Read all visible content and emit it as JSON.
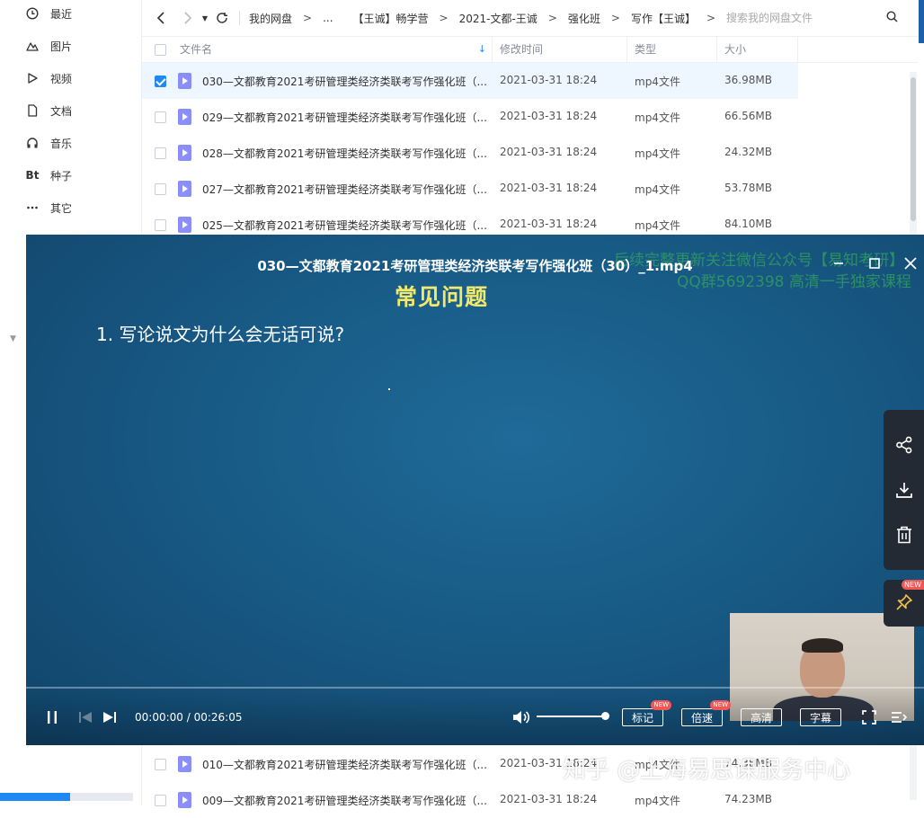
{
  "sidebar": {
    "items": [
      {
        "label": "最近",
        "icon": "clock-icon"
      },
      {
        "label": "图片",
        "icon": "image-icon"
      },
      {
        "label": "视频",
        "icon": "play-icon"
      },
      {
        "label": "文档",
        "icon": "document-icon"
      },
      {
        "label": "音乐",
        "icon": "headphones-icon"
      },
      {
        "label": "种子",
        "icon": "bt-icon",
        "glyph": "Bt"
      },
      {
        "label": "其它",
        "icon": "more-icon"
      }
    ],
    "storage_fill": 0.53
  },
  "toolbar": {
    "breadcrumbs": [
      "我的网盘",
      "...",
      "【王诚】畅学营",
      "2021-文都-王诚",
      "强化班",
      "写作【王诚】"
    ],
    "search_placeholder": "搜索我的网盘文件"
  },
  "table": {
    "headers": {
      "name": "文件名",
      "modified": "修改时间",
      "type": "类型",
      "size": "大小"
    },
    "rows": [
      {
        "name": "030—文都教育2021考研管理类经济类联考写作强化班（...",
        "time": "2021-03-31 18:24",
        "type": "mp4文件",
        "size": "36.98MB",
        "selected": true
      },
      {
        "name": "029—文都教育2021考研管理类经济类联考写作强化班（...",
        "time": "2021-03-31 18:24",
        "type": "mp4文件",
        "size": "66.56MB",
        "selected": false
      },
      {
        "name": "028—文都教育2021考研管理类经济类联考写作强化班（...",
        "time": "2021-03-31 18:24",
        "type": "mp4文件",
        "size": "24.32MB",
        "selected": false
      },
      {
        "name": "027—文都教育2021考研管理类经济类联考写作强化班（...",
        "time": "2021-03-31 18:24",
        "type": "mp4文件",
        "size": "53.78MB",
        "selected": false
      },
      {
        "name": "025—文都教育2021考研管理类经济类联考写作强化班（...",
        "time": "2021-03-31 18:24",
        "type": "mp4文件",
        "size": "84.10MB",
        "selected": false
      },
      {
        "name": "010—文都教育2021考研管理类经济类联考写作强化班（...",
        "time": "2021-03-31 18:24",
        "type": "mp4文件",
        "size": "74.38MB",
        "selected": false
      },
      {
        "name": "009—文都教育2021考研管理类经济类联考写作强化班（...",
        "time": "2021-03-31 18:24",
        "type": "mp4文件",
        "size": "74.23MB",
        "selected": false
      }
    ]
  },
  "player": {
    "title": "030—文都教育2021考研管理类经济类联考写作强化班（30）_1.mp4",
    "slide_heading": "常见问题",
    "slide_line": "1.  写论说文为什么会无话可说?",
    "watermark_line1": "后续完整更新关注微信公众号【易知考研】",
    "watermark_line2": "QQ群5692398 高清一手独家课程",
    "current_time": "00:00:00",
    "duration": "00:26:05",
    "time_sep": " / ",
    "volume": 1.0,
    "progress": 0.0,
    "buttons": {
      "mark": "标记",
      "speed": "倍速",
      "quality": "高清",
      "subtitle": "字幕"
    },
    "new_tag": "NEW",
    "side_new_tag": "NEW"
  },
  "overlay_watermark": "知乎 @上海易思课服务中心",
  "colors": {
    "accent": "#1e88f5",
    "player_bg": "#15476b",
    "heading_yellow": "#f2e96a",
    "new_red": "#f25757"
  }
}
